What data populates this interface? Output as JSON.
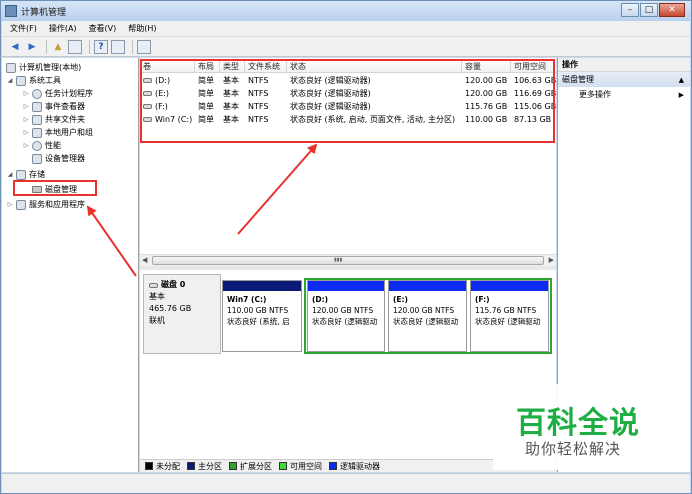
{
  "window": {
    "title": "计算机管理"
  },
  "menu": [
    "文件(F)",
    "操作(A)",
    "查看(V)",
    "帮助(H)"
  ],
  "tree": {
    "root": "计算机管理(本地)",
    "system_tools": "系统工具",
    "task_scheduler": "任务计划程序",
    "event_viewer": "事件查看器",
    "shared_folders": "共享文件夹",
    "local_users": "本地用户和组",
    "performance": "性能",
    "device_manager": "设备管理器",
    "storage": "存储",
    "disk_management": "磁盘管理",
    "services": "服务和应用程序"
  },
  "volumes": {
    "headers": [
      "卷",
      "布局",
      "类型",
      "文件系统",
      "状态",
      "容量",
      "可用空间"
    ],
    "rows": [
      {
        "vol": "(D:)",
        "layout": "简单",
        "type": "基本",
        "fs": "NTFS",
        "status": "状态良好 (逻辑驱动器)",
        "capacity": "120.00 GB",
        "free": "106.63 GB"
      },
      {
        "vol": "(E:)",
        "layout": "简单",
        "type": "基本",
        "fs": "NTFS",
        "status": "状态良好 (逻辑驱动器)",
        "capacity": "120.00 GB",
        "free": "116.69 GB"
      },
      {
        "vol": "(F:)",
        "layout": "简单",
        "type": "基本",
        "fs": "NTFS",
        "status": "状态良好 (逻辑驱动器)",
        "capacity": "115.76 GB",
        "free": "115.06 GB"
      },
      {
        "vol": "Win7 (C:)",
        "layout": "简单",
        "type": "基本",
        "fs": "NTFS",
        "status": "状态良好 (系统, 启动, 页面文件, 活动, 主分区)",
        "capacity": "110.00 GB",
        "free": "87.13 GB"
      }
    ]
  },
  "disk": {
    "name": "磁盘 0",
    "type": "基本",
    "size": "465.76 GB",
    "state": "联机",
    "partitions": [
      {
        "name": "Win7  (C:)",
        "size": "110.00 GB NTFS",
        "status": "状态良好 (系统, 启",
        "bar_color": "#0a1a78"
      },
      {
        "name": "(D:)",
        "size": "120.00 GB NTFS",
        "status": "状态良好 (逻辑驱动",
        "bar_color": "#0b2cf0"
      },
      {
        "name": "(E:)",
        "size": "120.00 GB NTFS",
        "status": "状态良好 (逻辑驱动",
        "bar_color": "#0b2cf0"
      },
      {
        "name": "(F:)",
        "size": "115.76 GB NTFS",
        "status": "状态良好 (逻辑驱动",
        "bar_color": "#0b2cf0"
      }
    ]
  },
  "legend": [
    {
      "label": "未分配",
      "color": "#000000"
    },
    {
      "label": "主分区",
      "color": "#0a1a78"
    },
    {
      "label": "扩展分区",
      "color": "#2ea52e"
    },
    {
      "label": "可用空间",
      "color": "#36e036"
    },
    {
      "label": "逻辑驱动器",
      "color": "#0b2cf0"
    }
  ],
  "actions": {
    "header": "操作",
    "section": "磁盘管理",
    "more": "更多操作"
  },
  "watermark": {
    "main": "百科全说",
    "sub": "助你轻松解决"
  },
  "colors": {
    "annotation": "#e8322e",
    "extended_frame": "#2ea52e"
  }
}
